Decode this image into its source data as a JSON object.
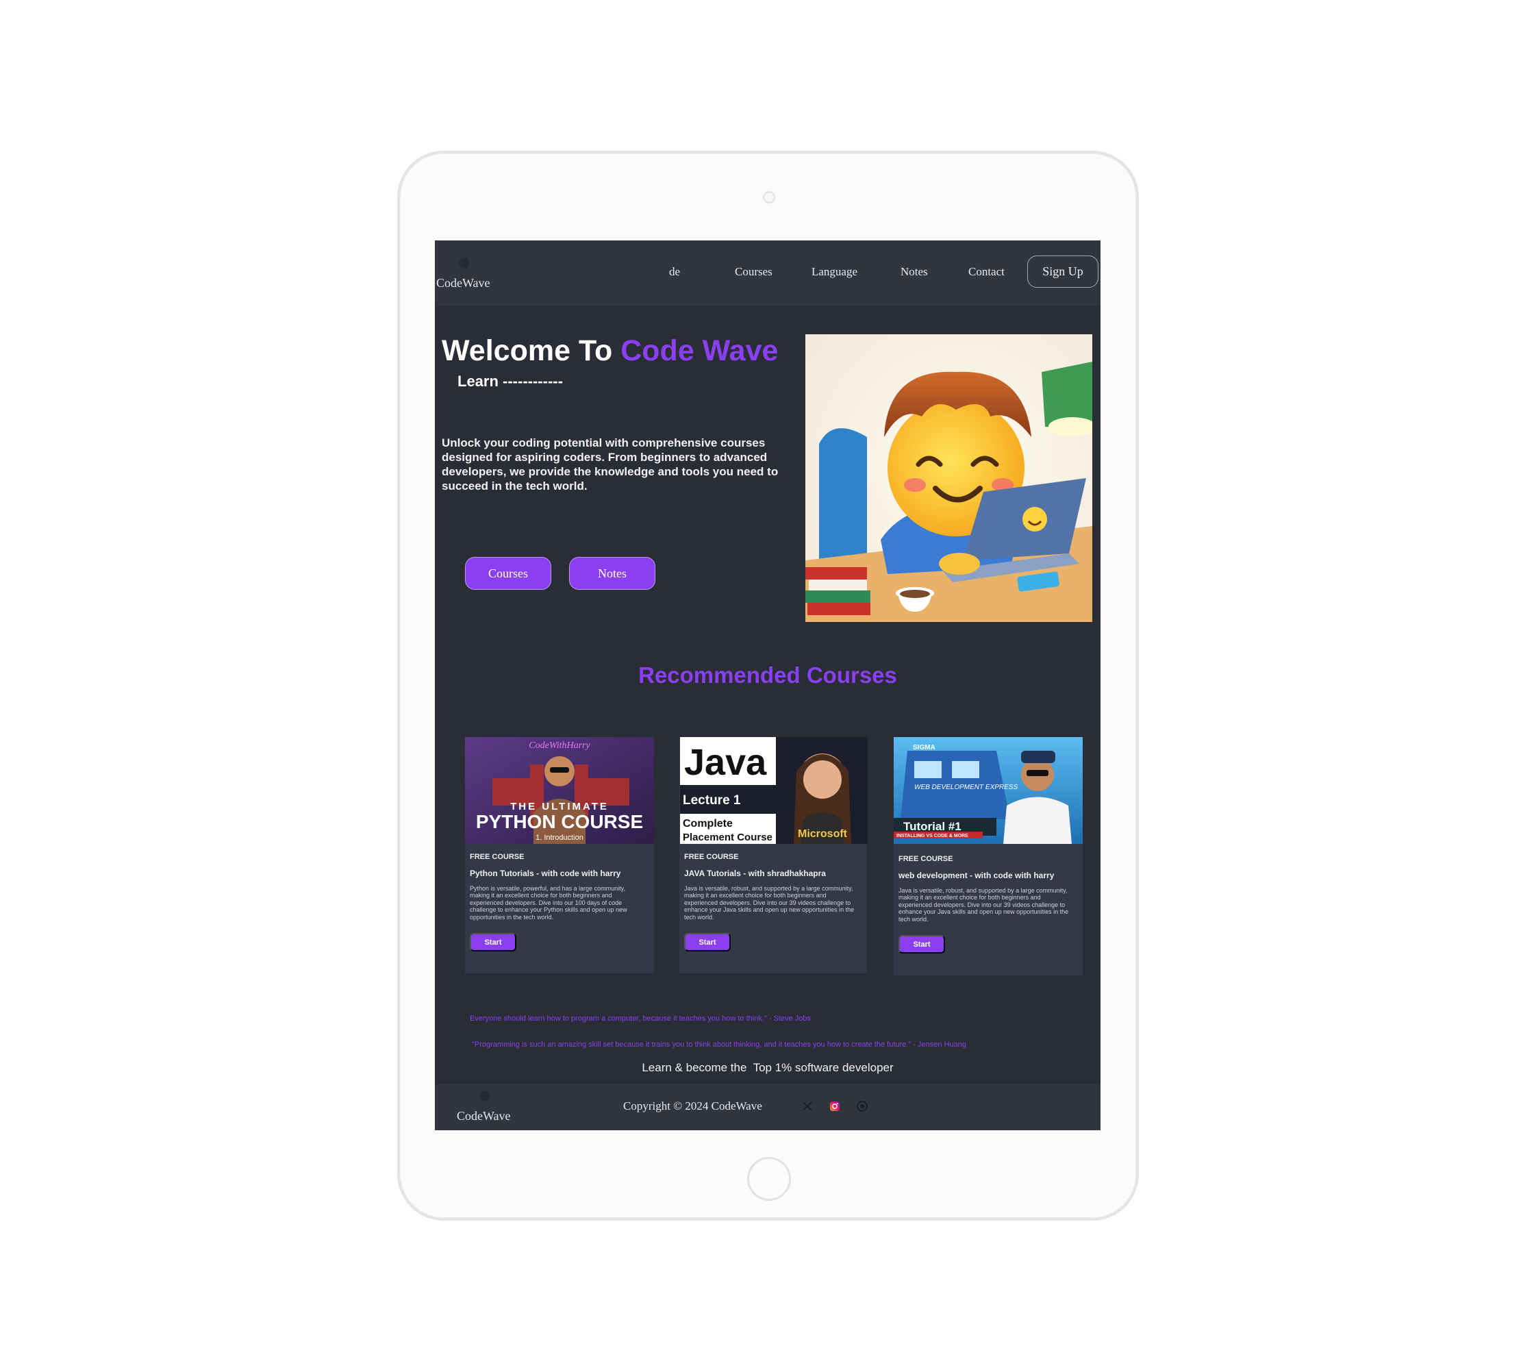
{
  "nav": {
    "logo_text": "CodeWave",
    "links": [
      "de",
      "Courses",
      "Language",
      "Notes",
      "Contact"
    ],
    "signup_label": "Sign Up"
  },
  "hero": {
    "title_plain": "Welcome To ",
    "title_accent": "Code Wave",
    "learn_line": "Learn ------------",
    "description": "Unlock your coding potential with comprehensive courses designed for aspiring coders. From beginners to advanced developers, we provide the knowledge and tools you need to succeed in the tech world.",
    "buttons": [
      "Courses",
      "Notes"
    ]
  },
  "section": {
    "title": "Recommended Courses"
  },
  "courses": [
    {
      "thumb_top": "CodeWithHarry",
      "thumb_line1": "THE ULTIMATE",
      "thumb_line2": "PYTHON COURSE",
      "thumb_line3": "1. Introduction",
      "tag": "FREE COURSE",
      "title": "Python Tutorials - with code with harry",
      "description": "Python is versatile, powerful, and has a large community, making it an excellent choice for both beginners and experienced developers. Dive into our 100 days of code challenge to enhance your Python skills and open up new opportunities in the tech world.",
      "button": "Start"
    },
    {
      "thumb_line1": "Java",
      "thumb_line2": "Lecture 1",
      "thumb_line3": "Complete",
      "thumb_line4": "Placement Course",
      "thumb_line5": "Microsoft",
      "tag": "FREE COURSE",
      "title": "JAVA Tutorials - with shradhakhapra",
      "description": "Java is versatile, robust, and supported by a large community, making it an excellent choice for both beginners and experienced developers. Dive into our 39 videos challenge to enhance your Java skills and open up new opportunities in the tech world.",
      "button": "Start"
    },
    {
      "thumb_line1": "SIGMA",
      "thumb_line2": "WEB DEVELOPMENT EXPRESS",
      "thumb_line3": "Tutorial #1",
      "thumb_line4": "INSTALLING VS CODE & MORE",
      "tag": "FREE COURSE",
      "title": "web development - with code with harry",
      "description": "Java is versatile, robust, and supported by a large community, making it an excellent choice for both beginners and experienced developers. Dive into our 39 videos challenge to enhance your Java skills and open up new opportunities in the tech world.",
      "button": "Start"
    }
  ],
  "quotes": [
    "Everyone should learn how to program a computer, because it teaches you how to think.\" - Steve Jobs",
    "\"Programming is such an amazing skill set because it trains you to think about thinking, and it teaches you how to create the future.\" - Jensen Huang"
  ],
  "tagline": "Learn & become the  Top 1% software developer",
  "footer": {
    "logo_text": "CodeWave",
    "copyright": "Copyright © 2024 CodeWave",
    "social_icons": [
      "x-icon",
      "instagram-icon",
      "github-icon"
    ]
  },
  "colors": {
    "accent": "#8a3ff0",
    "background": "#2a2c36",
    "nav": "#323540",
    "card": "#343847"
  }
}
